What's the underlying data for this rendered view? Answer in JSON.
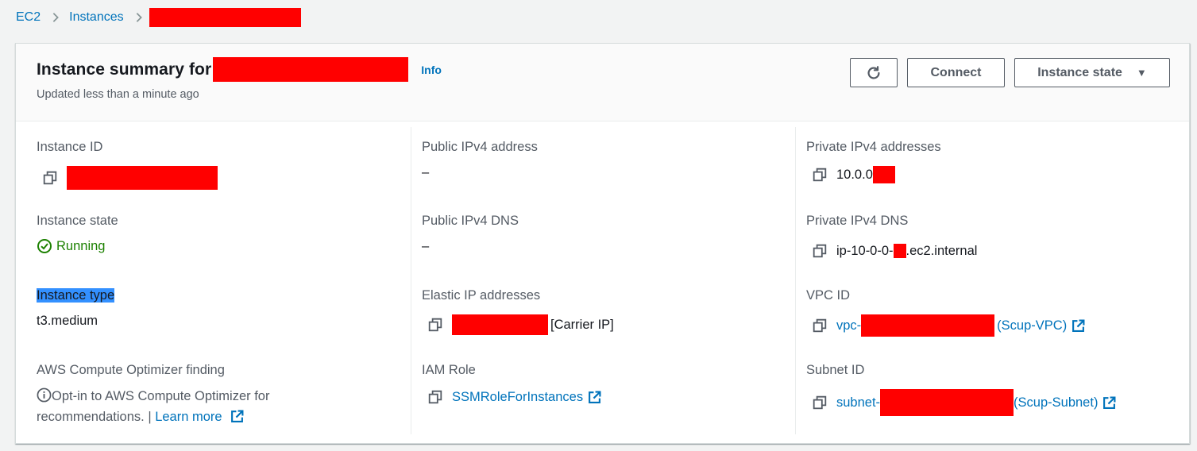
{
  "breadcrumb": {
    "items": [
      {
        "label": "EC2"
      },
      {
        "label": "Instances"
      }
    ]
  },
  "header": {
    "title": "Instance summary for",
    "info_label": "Info",
    "subtitle": "Updated less than a minute ago",
    "connect_label": "Connect",
    "instance_state_label": "Instance state"
  },
  "fields": {
    "instance_id": {
      "label": "Instance ID"
    },
    "public_ipv4": {
      "label": "Public IPv4 address",
      "value": "–"
    },
    "private_ipv4": {
      "label": "Private IPv4 addresses",
      "value": "10.0.0"
    },
    "instance_state": {
      "label": "Instance state",
      "value": "Running"
    },
    "public_dns": {
      "label": "Public IPv4 DNS",
      "value": "–"
    },
    "private_dns": {
      "label": "Private IPv4 DNS",
      "value_prefix": "ip-10-0-0-",
      "value_suffix": ".ec2.internal"
    },
    "instance_type": {
      "label": "Instance type",
      "value": "t3.medium"
    },
    "elastic_ip": {
      "label": "Elastic IP addresses",
      "suffix": "[Carrier IP]"
    },
    "vpc_id": {
      "label": "VPC ID",
      "prefix": "vpc-",
      "suffix": "(Scup-VPC)"
    },
    "optimizer": {
      "label": "AWS Compute Optimizer finding",
      "text": "Opt-in to AWS Compute Optimizer for recommendations. |",
      "learn_more": "Learn more"
    },
    "iam_role": {
      "label": "IAM Role",
      "value": "SSMRoleForInstances"
    },
    "subnet_id": {
      "label": "Subnet ID",
      "prefix": "subnet-",
      "suffix": "(Scup-Subnet)"
    }
  },
  "colors": {
    "link": "#0073bb",
    "running": "#1d8102",
    "redaction": "#ff0000",
    "selection": "#3390ff"
  },
  "icons": [
    "chevron-right-icon",
    "refresh-icon",
    "caret-down-icon",
    "copy-icon",
    "check-circle-icon",
    "info-circle-icon",
    "external-link-icon"
  ]
}
